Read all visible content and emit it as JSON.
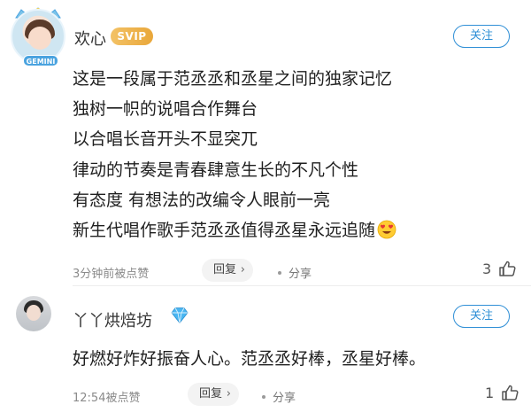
{
  "comments": [
    {
      "username": "欢心",
      "badge": "SVIP",
      "avatar_badge": "GEMINI",
      "follow_label": "关注",
      "lines": [
        "这是一段属于范丞丞和丞星之间的独家记忆",
        "独树一帜的说唱合作舞台",
        "以合唱长音开头不显突兀",
        "律动的节奏是青春肆意生长的不凡个性",
        "有态度 有想法的改编令人眼前一亮",
        "新生代唱作歌手范丞丞值得丞星永远追随"
      ],
      "emoji": "heart-eyes-emoji",
      "meta": "3分钟前被点赞",
      "reply_label": "回复",
      "share_label": "分享",
      "likes": "3"
    },
    {
      "username": "丫丫烘焙坊",
      "badge_icon": "diamond-icon",
      "follow_label": "关注",
      "lines": [
        "好燃好炸好振奋人心。范丞丞好棒，丞星好棒。"
      ],
      "meta": "12:54被点赞",
      "reply_label": "回复",
      "share_label": "分享",
      "likes": "1"
    }
  ],
  "colors": {
    "accent": "#2f8fd6",
    "svip_gold": "#e9a73a",
    "muted_text": "#8a8a8a"
  }
}
